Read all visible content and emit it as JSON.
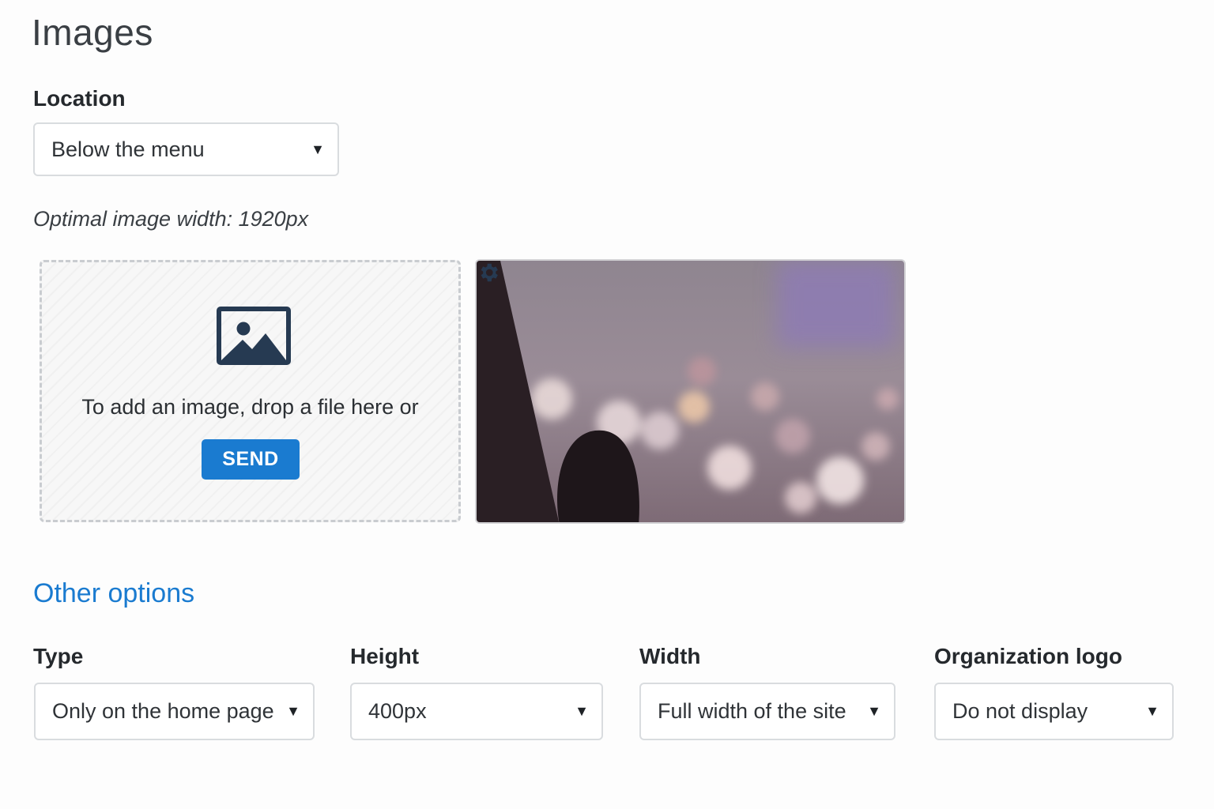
{
  "page": {
    "title": "Images"
  },
  "location": {
    "label": "Location",
    "value": "Below the menu"
  },
  "hint": "Optimal image width: 1920px",
  "dropzone": {
    "text": "To add an image, drop a file here or",
    "button_label": "SEND",
    "icon": "image-icon"
  },
  "preview": {
    "settings_icon": "gear-icon"
  },
  "other_options": {
    "title": "Other options",
    "type": {
      "label": "Type",
      "value": "Only on the home page"
    },
    "height": {
      "label": "Height",
      "value": "400px"
    },
    "width": {
      "label": "Width",
      "value": "Full width of the site"
    },
    "logo": {
      "label": "Organization logo",
      "value": "Do not display"
    }
  },
  "colors": {
    "accent": "#1a7bd0",
    "icon_dark": "#263a52"
  }
}
